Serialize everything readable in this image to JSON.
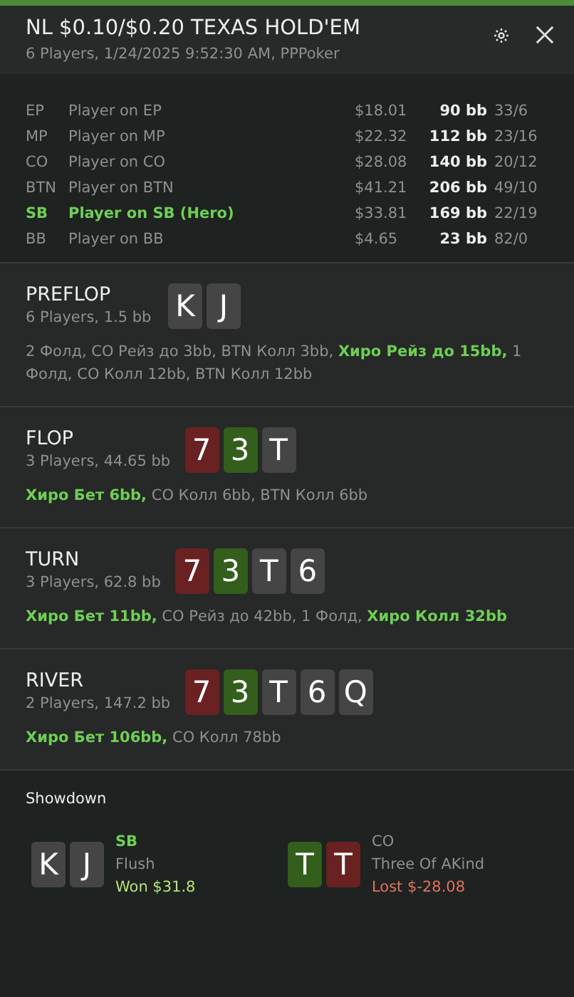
{
  "header": {
    "title": "NL $0.10/$0.20 TEXAS HOLD'EM",
    "subtitle": "6 Players, 1/24/2025 9:52:30 AM, PPPoker"
  },
  "players": [
    {
      "position": "EP",
      "name": "Player on EP",
      "stack": "$18.01",
      "bb": "90 bb",
      "stats": "33/6",
      "hero": false
    },
    {
      "position": "MP",
      "name": "Player on MP",
      "stack": "$22.32",
      "bb": "112 bb",
      "stats": "23/16",
      "hero": false
    },
    {
      "position": "CO",
      "name": "Player on CO",
      "stack": "$28.08",
      "bb": "140 bb",
      "stats": "20/12",
      "hero": false
    },
    {
      "position": "BTN",
      "name": "Player on BTN",
      "stack": "$41.21",
      "bb": "206 bb",
      "stats": "49/10",
      "hero": false
    },
    {
      "position": "SB",
      "name": "Player on SB (Hero)",
      "stack": "$33.81",
      "bb": "169 bb",
      "stats": "22/19",
      "hero": true
    },
    {
      "position": "BB",
      "name": "Player on BB",
      "stack": "$4.65",
      "bb": "23 bb",
      "stats": "82/0",
      "hero": false
    }
  ],
  "streets": [
    {
      "name": "PREFLOP",
      "info": "6 Players, 1.5 bb",
      "cards": [
        {
          "rank": "K",
          "color": "#454545"
        },
        {
          "rank": "J",
          "color": "#454545"
        }
      ],
      "actions": "2 Фолд, CO Рейз до 3bb, BTN Колл 3bb, **Хиро Рейз до 15bb,** 1 Фолд, CO Колл 12bb, BTN Колл 12bb"
    },
    {
      "name": "FLOP",
      "info": "3 Players, 44.65 bb",
      "cards": [
        {
          "rank": "7",
          "color": "#6a2121"
        },
        {
          "rank": "3",
          "color": "#335e1c"
        },
        {
          "rank": "T",
          "color": "#454545"
        }
      ],
      "actions": "**Хиро Бет 6bb,** CO Колл 6bb, BTN Колл 6bb"
    },
    {
      "name": "TURN",
      "info": "3 Players, 62.8 bb",
      "cards": [
        {
          "rank": "7",
          "color": "#6a2121"
        },
        {
          "rank": "3",
          "color": "#335e1c"
        },
        {
          "rank": "T",
          "color": "#454545"
        },
        {
          "rank": "6",
          "color": "#454545"
        }
      ],
      "actions": "**Хиро Бет 11bb,** CO Рейз до 42bb, 1 Фолд, **Хиро Колл 32bb**"
    },
    {
      "name": "RIVER",
      "info": "2 Players, 147.2 bb",
      "cards": [
        {
          "rank": "7",
          "color": "#6a2121"
        },
        {
          "rank": "3",
          "color": "#335e1c"
        },
        {
          "rank": "T",
          "color": "#454545"
        },
        {
          "rank": "6",
          "color": "#454545"
        },
        {
          "rank": "Q",
          "color": "#454545"
        }
      ],
      "actions": "**Хиро Бет 106bb,** CO Колл 78bb"
    }
  ],
  "showdown": {
    "title": "Showdown",
    "hands": [
      {
        "position": "SB",
        "hero": true,
        "won": true,
        "hand": "Flush",
        "result": "Won $31.8",
        "cards": [
          {
            "rank": "K",
            "color": "#454545"
          },
          {
            "rank": "J",
            "color": "#454545"
          }
        ]
      },
      {
        "position": "CO",
        "hero": false,
        "won": false,
        "hand": "Three Of AKind",
        "result": "Lost $-28.08",
        "cards": [
          {
            "rank": "T",
            "color": "#335e1c"
          },
          {
            "rank": "T",
            "color": "#6a2121"
          }
        ]
      }
    ]
  }
}
